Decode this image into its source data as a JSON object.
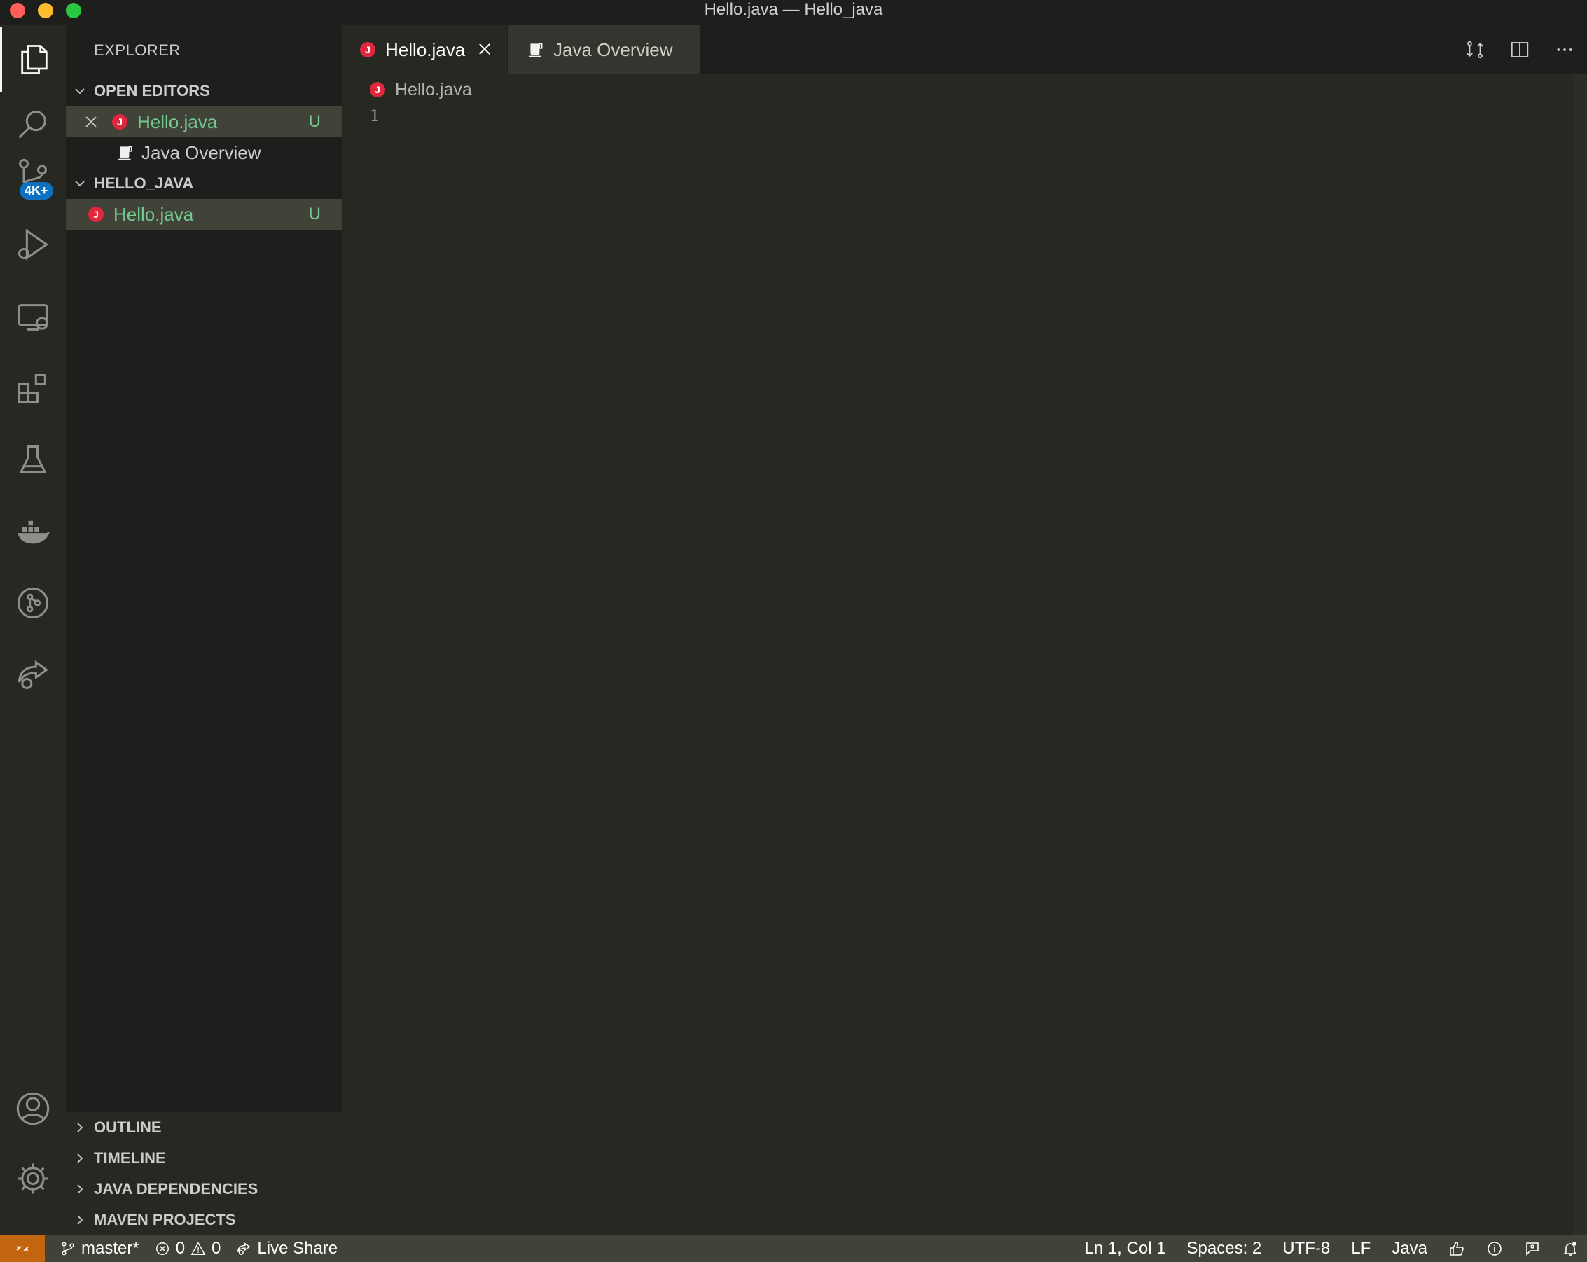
{
  "window": {
    "title": "Hello.java — Hello_java"
  },
  "activity_bar": {
    "source_control_badge": "4K+"
  },
  "sidebar": {
    "title": "EXPLORER",
    "open_editors": {
      "header": "OPEN EDITORS",
      "items": [
        {
          "label": "Hello.java",
          "status": "U"
        },
        {
          "label": "Java Overview"
        }
      ]
    },
    "folder": {
      "header": "HELLO_JAVA",
      "items": [
        {
          "label": "Hello.java",
          "status": "U"
        }
      ]
    },
    "bottom_sections": [
      "OUTLINE",
      "TIMELINE",
      "JAVA DEPENDENCIES",
      "MAVEN PROJECTS"
    ]
  },
  "editor": {
    "tabs": [
      {
        "label": "Hello.java"
      },
      {
        "label": "Java Overview"
      }
    ],
    "breadcrumb": "Hello.java",
    "line_number": "1"
  },
  "status_bar": {
    "branch": "master*",
    "errors": "0",
    "warnings": "0",
    "live_share": "Live Share",
    "position": "Ln 1, Col 1",
    "spaces": "Spaces: 2",
    "encoding": "UTF-8",
    "eol": "LF",
    "language": "Java"
  },
  "colors": {
    "accent_green": "#73c991",
    "java_icon": "#e0273e",
    "remote_indicator": "#c1660f",
    "badge_blue": "#0e70c0"
  }
}
